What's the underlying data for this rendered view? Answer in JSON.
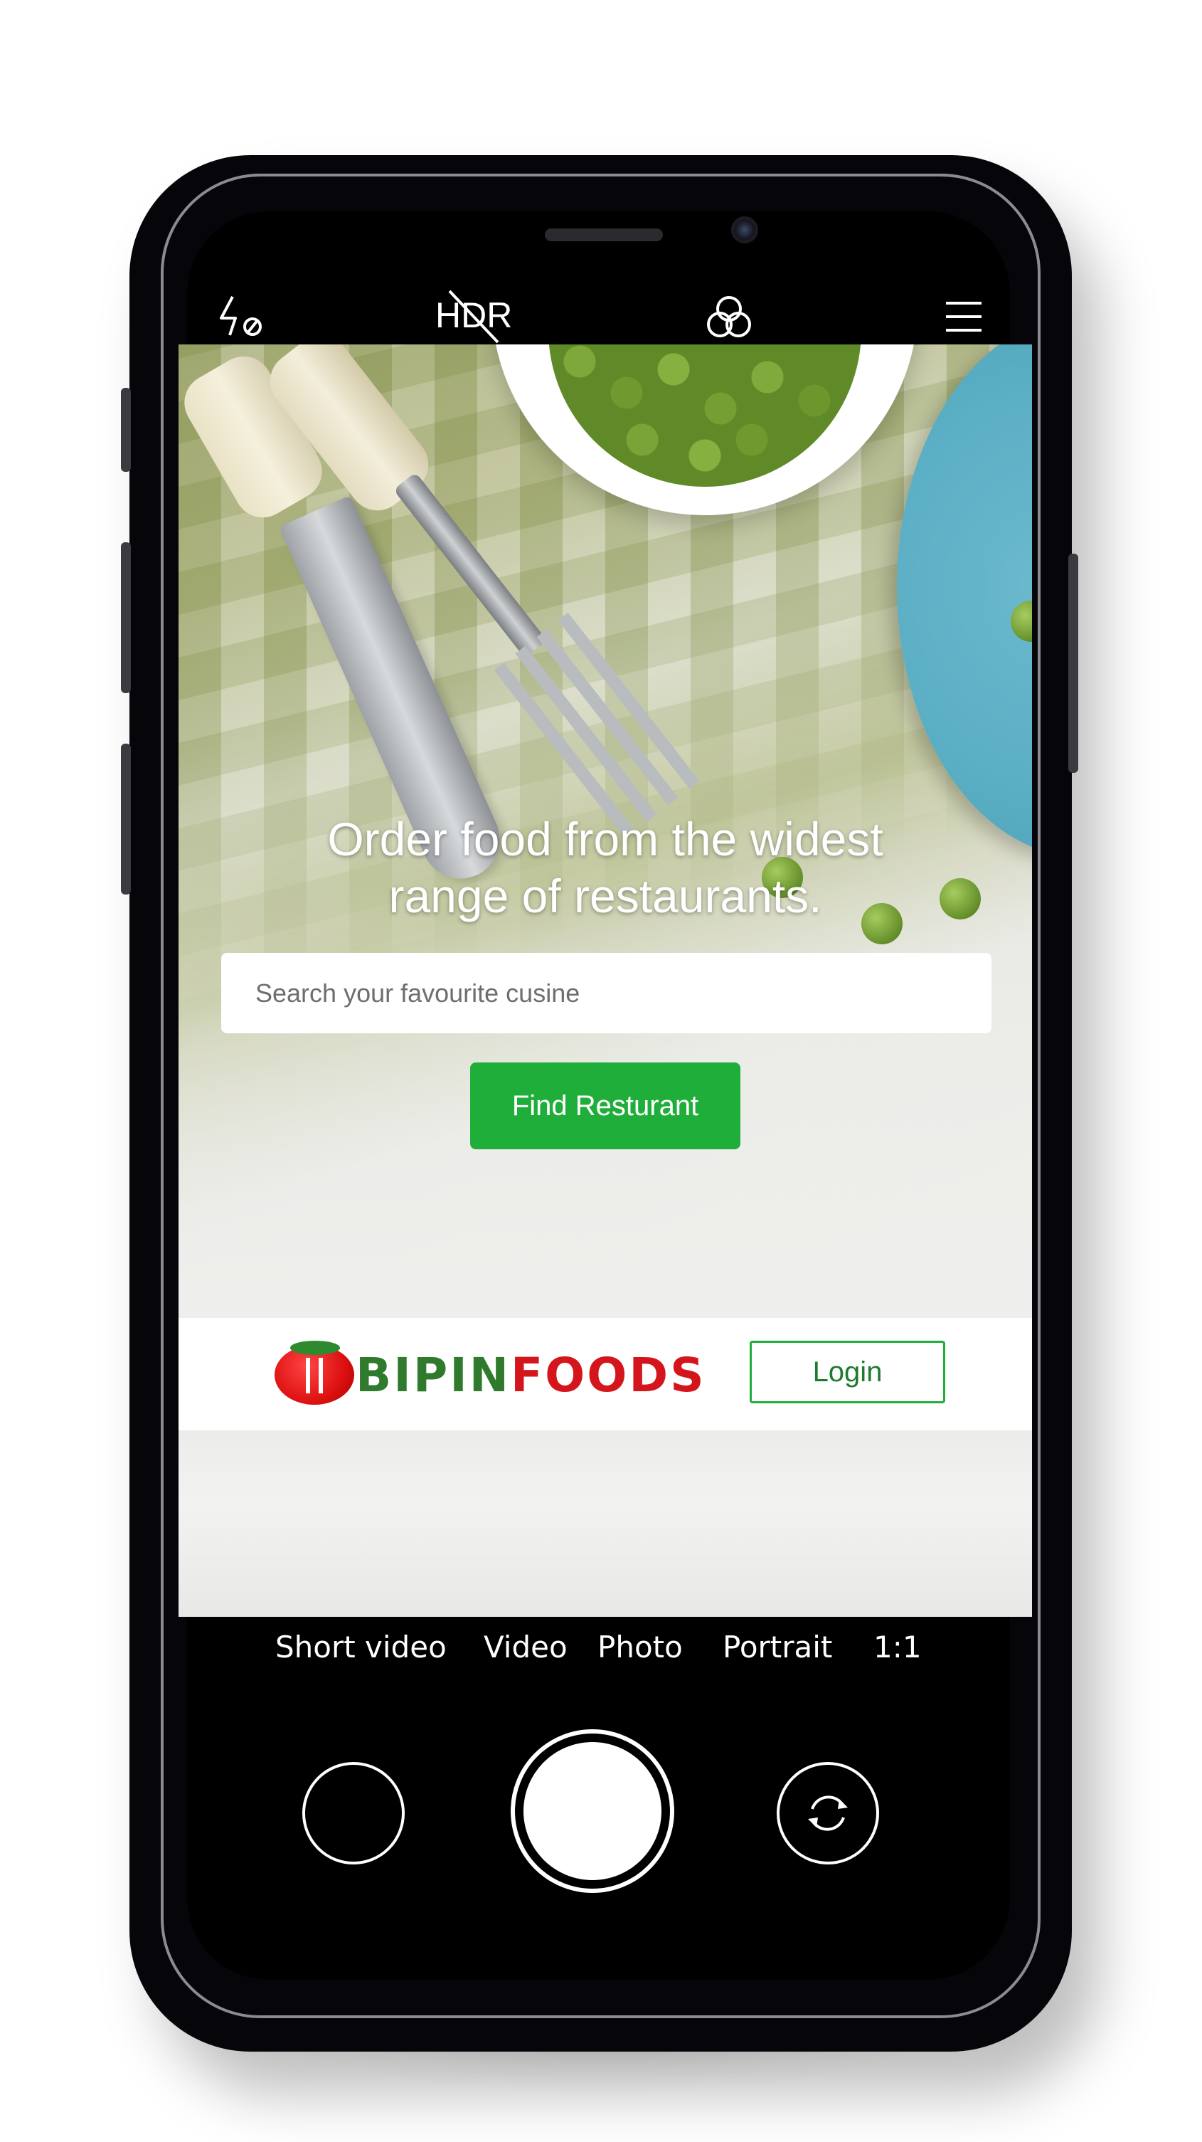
{
  "camera": {
    "top_bar": {
      "flash_icon": "flash-off-icon",
      "hdr_label": "HDR",
      "filters_icon": "filters-icon",
      "menu_icon": "hamburger-menu-icon"
    },
    "modes": [
      "Short video",
      "Video",
      "Photo",
      "Portrait",
      "1:1"
    ],
    "controls": {
      "gallery": "gallery-thumbnail",
      "shutter": "shutter-button",
      "flip": "switch-camera-icon"
    }
  },
  "web": {
    "hero": {
      "title_line1": "Order food from the widest",
      "title_line2": "range of restaurants."
    },
    "search": {
      "placeholder": "Search your favourite cusine",
      "value": ""
    },
    "find_button_label": "Find Resturant",
    "navbar": {
      "logo_part1": "BIPIN",
      "logo_part2": "FOODS",
      "login_label": "Login"
    }
  },
  "colors": {
    "accent_green": "#20ae3b",
    "logo_green": "#2f7a2c",
    "logo_red": "#d4161c"
  }
}
